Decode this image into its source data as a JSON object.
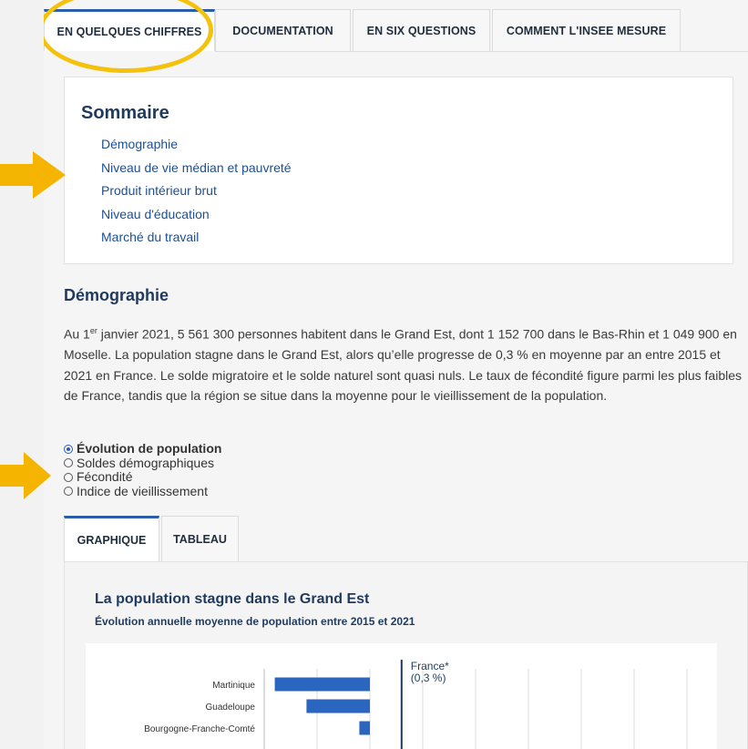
{
  "tabs": [
    {
      "label": "EN QUELQUES CHIFFRES",
      "active": true
    },
    {
      "label": "DOCUMENTATION",
      "active": false
    },
    {
      "label": "EN SIX QUESTIONS",
      "active": false
    },
    {
      "label": "COMMENT L'INSEE MESURE",
      "active": false
    }
  ],
  "summary": {
    "title": "Sommaire",
    "links": [
      "Démographie",
      "Niveau de vie médian et pauvreté",
      "Produit intérieur brut",
      "Niveau d'éducation",
      "Marché du travail"
    ]
  },
  "demographie": {
    "title": "Démographie",
    "para_prefix": "Au 1",
    "para_sup": "er",
    "para_text": " janvier 2021, 5 561 300 personnes habitent dans le Grand Est, dont 1 152 700 dans le Bas-Rhin et 1 049 900 en Moselle. La population stagne dans le Grand Est, alors qu’elle progresse de 0,3 % en moyenne par an entre 2015 et 2021 en France. Le solde migratoire et le solde naturel sont quasi nuls. Le taux de fécondité figure parmi les plus faibles de France, tandis que la région se situe dans la moyenne pour le vieillissement de la population."
  },
  "radios": [
    {
      "label": "Évolution de population",
      "checked": true
    },
    {
      "label": "Soldes démographiques",
      "checked": false
    },
    {
      "label": "Fécondité",
      "checked": false
    },
    {
      "label": "Indice de vieillissement",
      "checked": false
    }
  ],
  "subtabs": [
    {
      "label": "GRAPHIQUE",
      "active": true
    },
    {
      "label": "TABLEAU",
      "active": false
    }
  ],
  "chart": {
    "title": "La population stagne dans le Grand Est",
    "subtitle": "Évolution annuelle moyenne de population entre 2015 et 2021",
    "reference_label": "France*",
    "reference_value_label": "(0,3 %)"
  },
  "chart_data": {
    "type": "bar",
    "orientation": "horizontal",
    "categories": [
      "Martinique",
      "Guadeloupe",
      "Bourgogne-Franche-Comté"
    ],
    "values": [
      -0.9,
      -0.6,
      -0.1
    ],
    "unit": "%",
    "reference_line": {
      "label": "France*",
      "value": 0.3
    },
    "xlim": [
      -1.0,
      3.0
    ],
    "grid": true,
    "bar_color": "#2a66c0",
    "partially_visible": true
  },
  "colors": {
    "accent": "#2a5ea8",
    "link": "#1d4f91",
    "heading": "#1f3a5c",
    "annotation": "#f4c20d"
  }
}
